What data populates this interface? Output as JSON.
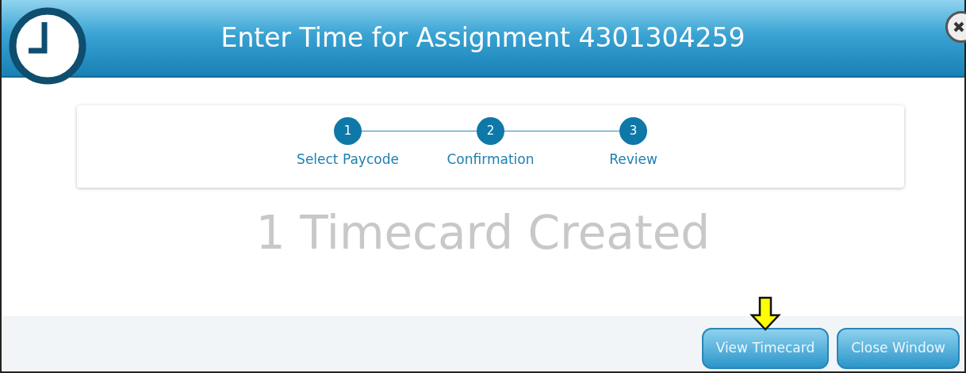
{
  "window": {
    "title": "Enter Time for Assignment 4301304259"
  },
  "steps": [
    {
      "number": "1",
      "label": "Select Paycode"
    },
    {
      "number": "2",
      "label": "Confirmation"
    },
    {
      "number": "3",
      "label": "Review"
    }
  ],
  "message": "1 Timecard Created",
  "buttons": [
    {
      "label": "View Timecard",
      "highlighted": true
    },
    {
      "label": "Close Window",
      "highlighted": false
    }
  ]
}
